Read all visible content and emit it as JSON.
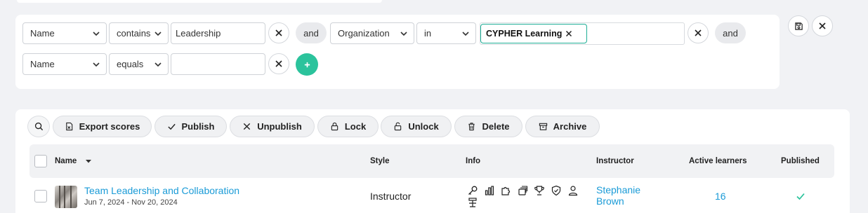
{
  "filters": {
    "row1": {
      "field": "Name",
      "operator": "contains",
      "value": "Leadership",
      "conjunction": "and",
      "field2": "Organization",
      "operator2": "in",
      "tag": "CYPHER Learning",
      "conjunction2": "and"
    },
    "row2": {
      "field": "Name",
      "operator": "equals",
      "value": ""
    },
    "add_label": "+"
  },
  "toolbar": {
    "export": "Export scores",
    "publish": "Publish",
    "unpublish": "Unpublish",
    "lock": "Lock",
    "unlock": "Unlock",
    "delete": "Delete",
    "archive": "Archive"
  },
  "table": {
    "headers": {
      "name": "Name",
      "style": "Style",
      "info": "Info",
      "instructor": "Instructor",
      "active_learners": "Active learners",
      "published": "Published"
    },
    "rows": [
      {
        "title": "Team Leadership and Collaboration",
        "dates": "Jun 7, 2024 - Nov 20, 2024",
        "style": "Instructor",
        "instructor_first": "Stephanie",
        "instructor_last": "Brown",
        "active_learners": "16",
        "published": true
      }
    ]
  },
  "colors": {
    "accent": "#2bc39c",
    "link": "#1a9bd7",
    "tag_border": "#1fae96"
  }
}
